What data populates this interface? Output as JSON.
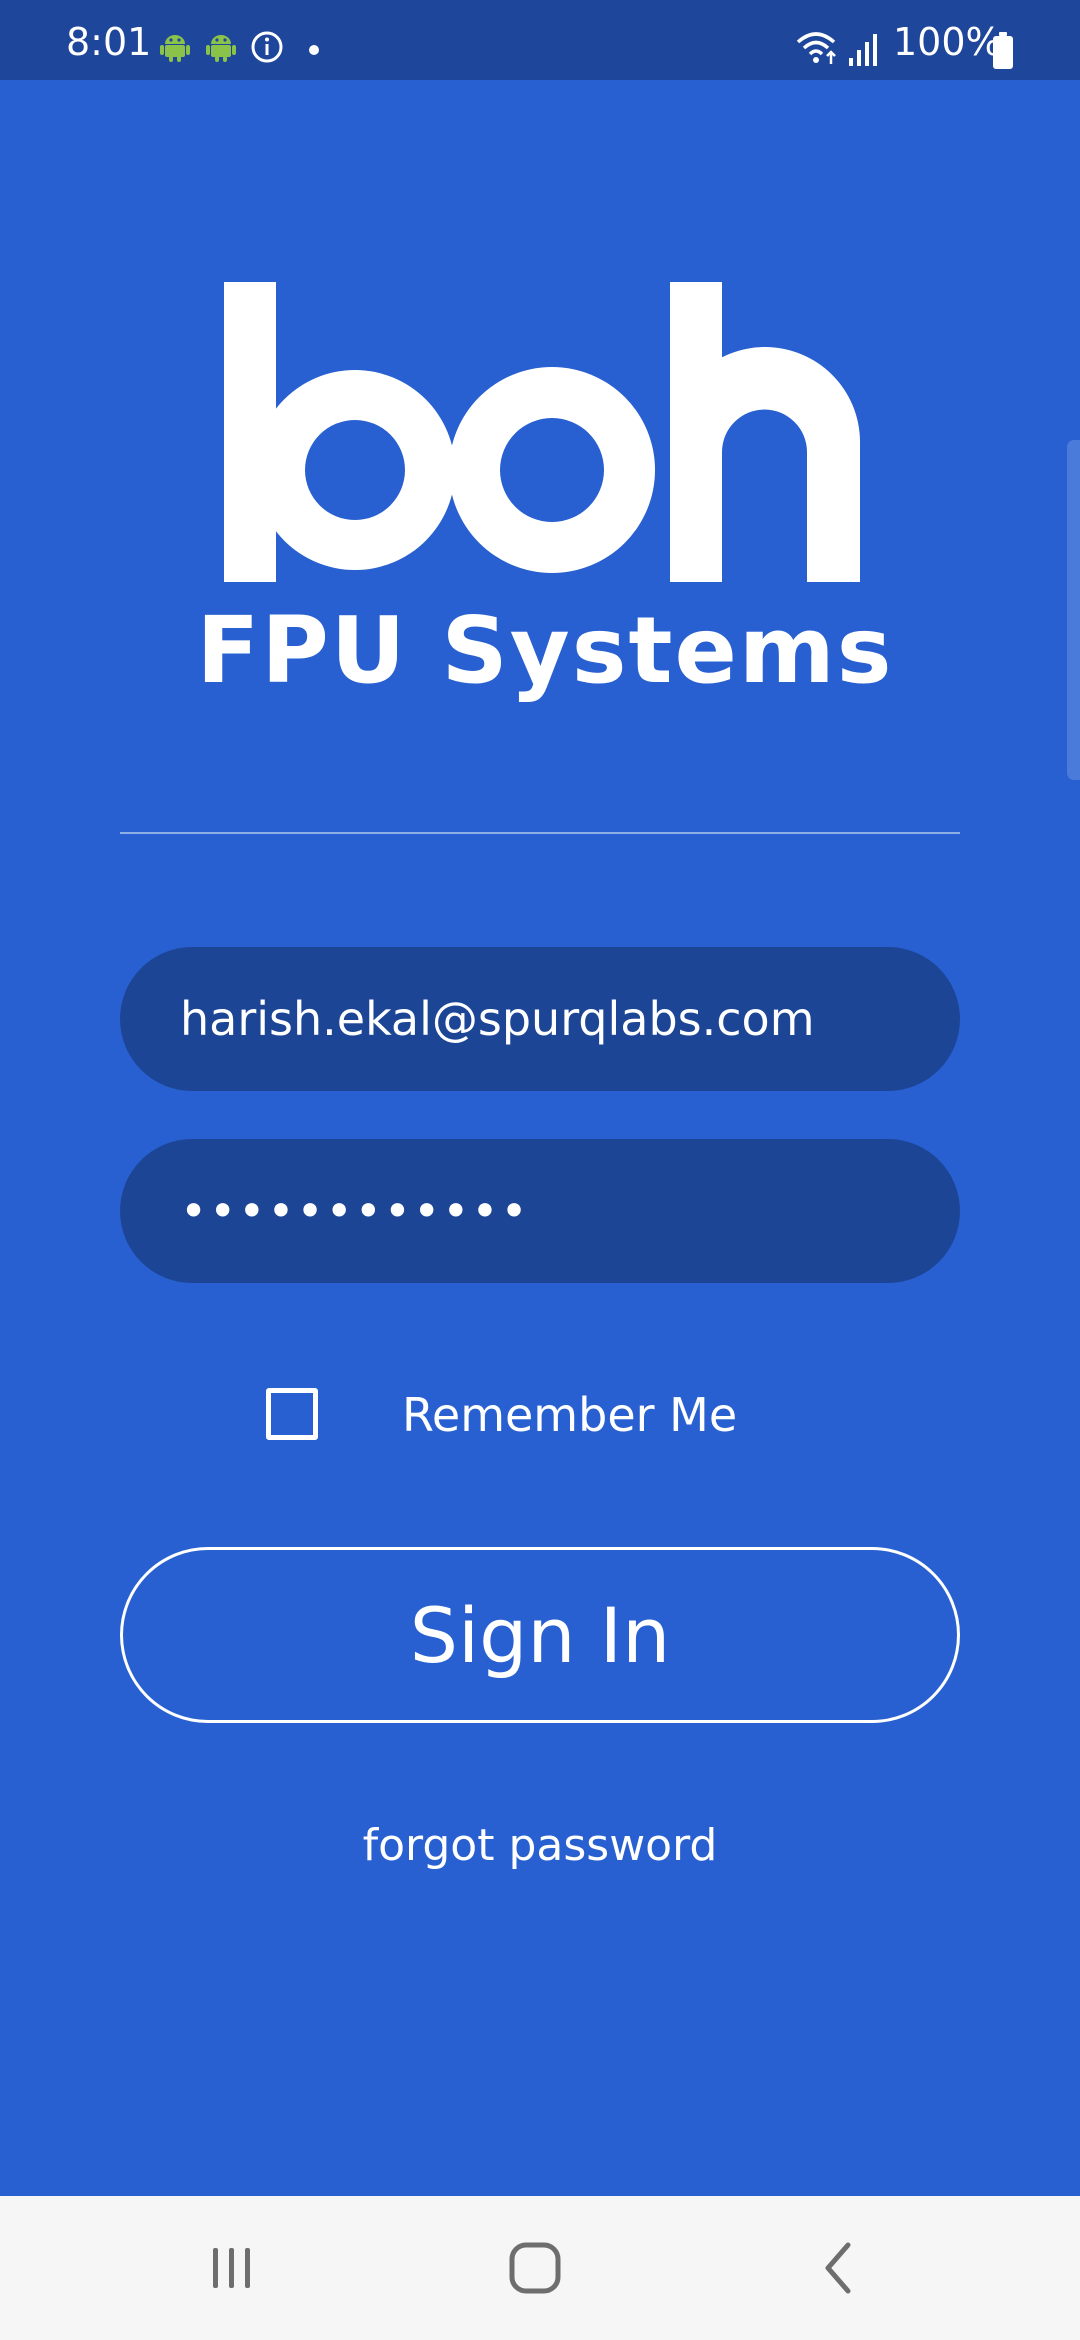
{
  "status_bar": {
    "time": "8:01",
    "battery": "100%",
    "icons": [
      "android-icon",
      "android-icon",
      "info-icon",
      "dot-icon",
      "wifi-icon",
      "signal-icon",
      "battery-icon"
    ]
  },
  "logo": {
    "brand": "boh",
    "subtitle": "FPU Systems"
  },
  "login": {
    "email_value": "harish.ekal@spurqlabs.com",
    "password_value": "••••••••••••",
    "remember_me_label": "Remember Me",
    "remember_me_checked": false,
    "sign_in_label": "Sign In",
    "forgot_password_label": "forgot password"
  },
  "nav_bar": {
    "buttons": [
      "recent-apps-icon",
      "home-icon",
      "back-icon"
    ]
  },
  "colors": {
    "background": "#2860D1",
    "status_bar": "#1E469A",
    "field": "#1D4595",
    "nav_bar": "#F6F6F6",
    "android_green": "#8BC34A"
  }
}
